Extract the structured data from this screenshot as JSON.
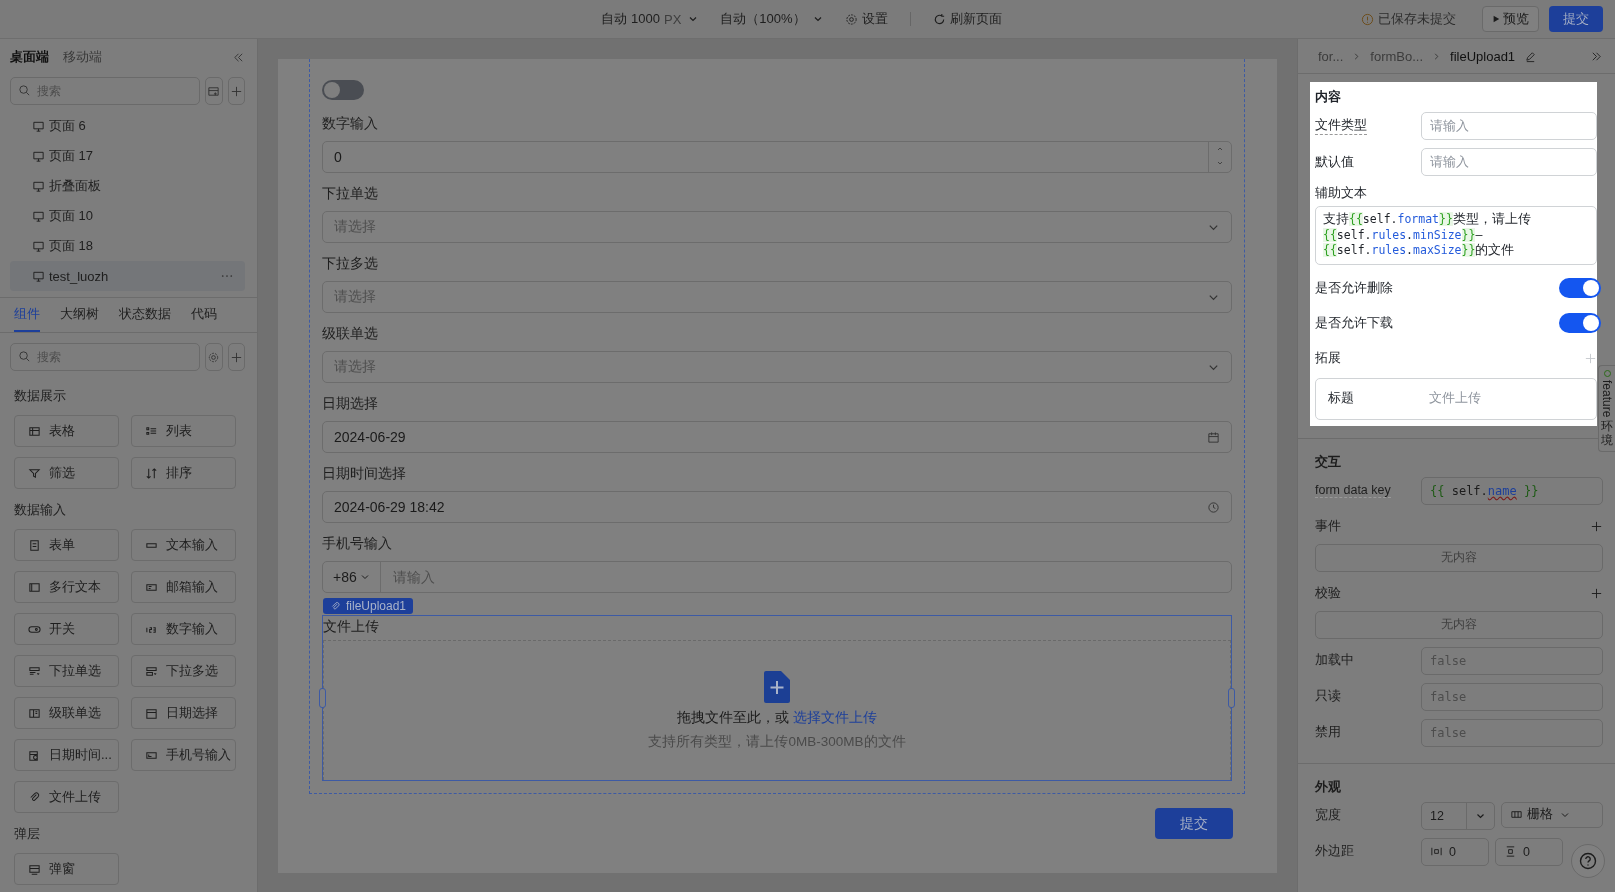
{
  "top_bar": {
    "width_select": "自动 1000",
    "width_unit": "PX",
    "zoom_select": "自动（100%）",
    "settings": "设置",
    "refresh": "刷新页面",
    "save_status": "已保存未提交",
    "preview": "预览",
    "submit": "提交"
  },
  "left_sidebar": {
    "platform_tabs": [
      {
        "label": "桌面端",
        "selected": true
      },
      {
        "label": "移动端",
        "selected": false
      }
    ],
    "page_search": {
      "placeholder": "搜索"
    },
    "pages": [
      {
        "label": "页面 6",
        "selected": false
      },
      {
        "label": "页面 17",
        "selected": false
      },
      {
        "label": "折叠面板",
        "selected": false
      },
      {
        "label": "页面 10",
        "selected": false
      },
      {
        "label": "页面 18",
        "selected": false
      },
      {
        "label": "test_luozh",
        "selected": true
      }
    ],
    "panel_tabs": [
      {
        "label": "组件",
        "selected": true
      },
      {
        "label": "大纲树",
        "selected": false
      },
      {
        "label": "状态数据",
        "selected": false
      },
      {
        "label": "代码",
        "selected": false
      }
    ],
    "component_search": {
      "placeholder": "搜索"
    },
    "groups": [
      {
        "title": "数据展示",
        "items": [
          {
            "label": "表格",
            "kind": "table"
          },
          {
            "label": "列表",
            "kind": "list"
          },
          {
            "label": "筛选",
            "kind": "filter"
          },
          {
            "label": "排序",
            "kind": "sort"
          }
        ]
      },
      {
        "title": "数据输入",
        "items": [
          {
            "label": "表单",
            "kind": "form"
          },
          {
            "label": "文本输入",
            "kind": "text"
          },
          {
            "label": "多行文本",
            "kind": "textarea"
          },
          {
            "label": "邮箱输入",
            "kind": "email"
          },
          {
            "label": "开关",
            "kind": "switch"
          },
          {
            "label": "数字输入",
            "kind": "number"
          },
          {
            "label": "下拉单选",
            "kind": "select"
          },
          {
            "label": "下拉多选",
            "kind": "multiselect"
          },
          {
            "label": "级联单选",
            "kind": "cascader"
          },
          {
            "label": "日期选择",
            "kind": "date"
          },
          {
            "label": "日期时间...",
            "kind": "datetime"
          },
          {
            "label": "手机号输入",
            "kind": "phone"
          },
          {
            "label": "文件上传",
            "kind": "upload"
          }
        ]
      },
      {
        "title": "弹层",
        "items": [
          {
            "label": "弹窗",
            "kind": "modal"
          }
        ]
      }
    ]
  },
  "canvas": {
    "fields": [
      {
        "kind": "switch",
        "on": false
      },
      {
        "kind": "number",
        "label": "数字输入",
        "value": "0"
      },
      {
        "kind": "select",
        "label": "下拉单选",
        "placeholder": "请选择"
      },
      {
        "kind": "select",
        "label": "下拉多选",
        "placeholder": "请选择"
      },
      {
        "kind": "select",
        "label": "级联单选",
        "placeholder": "请选择"
      },
      {
        "kind": "date",
        "label": "日期选择",
        "value": "2024-06-29"
      },
      {
        "kind": "datetime",
        "label": "日期时间选择",
        "value": "2024-06-29 18:42"
      },
      {
        "kind": "phone",
        "label": "手机号输入",
        "prefix": "+86",
        "placeholder": "请输入"
      }
    ],
    "selected_component": {
      "tag": "fileUpload1",
      "label": "文件上传",
      "drop_text": "拖拽文件至此，或",
      "drop_link": "选择文件上传",
      "hint": "支持所有类型，请上传0MB-300MB的文件"
    },
    "submit": "提交"
  },
  "inspector": {
    "breadcrumb": [
      "for...",
      "formBo...",
      "fileUpload1"
    ],
    "content": {
      "title": "内容",
      "fields": [
        {
          "kind": "input",
          "label": "文件类型",
          "placeholder": "请输入",
          "tooltip": true
        },
        {
          "kind": "input",
          "label": "默认值",
          "placeholder": "请输入",
          "tooltip": false
        },
        {
          "kind": "code",
          "label": "辅助文本",
          "segments": [
            {
              "kind": "text",
              "text": "支持"
            },
            {
              "kind": "brace",
              "text": "{{"
            },
            {
              "kind": "path",
              "text": "self."
            },
            {
              "kind": "prop",
              "text": "format"
            },
            {
              "kind": "brace",
              "text": "}}"
            },
            {
              "kind": "text",
              "text": "类型，请上传"
            },
            {
              "kind": "brace",
              "text": "{{"
            },
            {
              "kind": "path",
              "text": "self."
            },
            {
              "kind": "prop",
              "text": "rules"
            },
            {
              "kind": "path",
              "text": "."
            },
            {
              "kind": "prop",
              "text": "minSize"
            },
            {
              "kind": "brace",
              "text": "}}"
            },
            {
              "kind": "text",
              "text": "–"
            },
            {
              "kind": "brace",
              "text": "{{"
            },
            {
              "kind": "path",
              "text": "self."
            },
            {
              "kind": "prop",
              "text": "rules"
            },
            {
              "kind": "path",
              "text": "."
            },
            {
              "kind": "prop",
              "text": "maxSize"
            },
            {
              "kind": "brace",
              "text": "}}"
            },
            {
              "kind": "text",
              "text": "的文件"
            }
          ]
        },
        {
          "kind": "switch",
          "label": "是否允许删除",
          "on": true
        },
        {
          "kind": "switch",
          "label": "是否允许下载",
          "on": true
        }
      ],
      "extension": {
        "title": "拓展",
        "rows": [
          {
            "key": "标题",
            "value": "文件上传"
          }
        ]
      }
    },
    "env_tab": {
      "label": "feature",
      "suffix": "环境"
    },
    "interaction": {
      "title": "交互",
      "data_key": {
        "label": "form data key",
        "tooltip": true,
        "segments": [
          {
            "kind": "brace",
            "text": "{{ "
          },
          {
            "kind": "path",
            "text": "self."
          },
          {
            "kind": "prop",
            "text": "name"
          },
          {
            "kind": "brace",
            "text": " }}"
          }
        ]
      },
      "lists": [
        {
          "title": "事件",
          "empty": "无内容"
        },
        {
          "title": "校验",
          "empty": "无内容"
        }
      ],
      "flags": [
        {
          "label": "加载中",
          "placeholder": "false"
        },
        {
          "label": "只读",
          "placeholder": "false"
        },
        {
          "label": "禁用",
          "placeholder": "false"
        }
      ]
    },
    "appearance": {
      "title": "外观",
      "width": {
        "label": "宽度",
        "value": "12",
        "unit": "栅格"
      },
      "margin": {
        "label": "外边距",
        "horizontal": "0",
        "vertical": "0"
      }
    }
  }
}
